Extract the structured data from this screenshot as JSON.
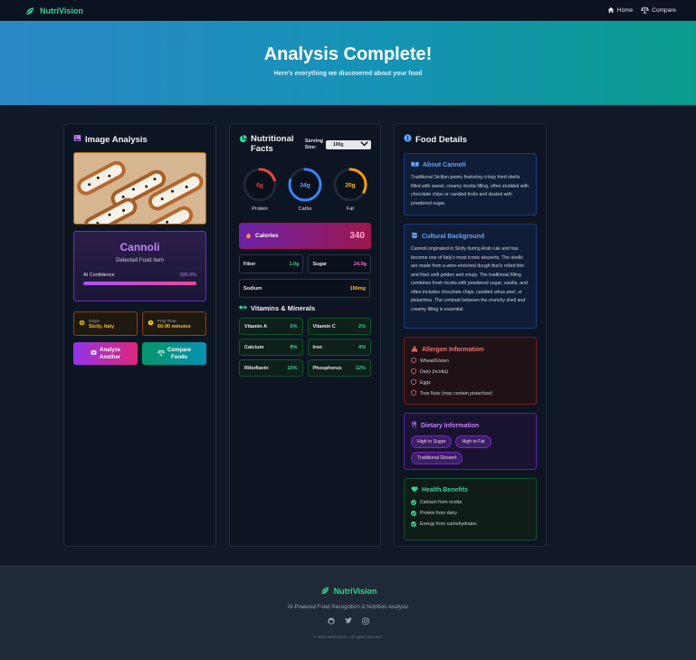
{
  "nav": {
    "brand": "NutriVision",
    "links": [
      {
        "label": "Home",
        "icon": "home-icon"
      },
      {
        "label": "Compare",
        "icon": "compare-icon"
      }
    ]
  },
  "hero": {
    "title": "Analysis Complete!",
    "subtitle": "Here's everything we discovered about your food"
  },
  "image_analysis": {
    "title": "Image Analysis",
    "food_name": "Cannoli",
    "detected_label": "Detected Food Item",
    "confidence_label": "AI Confidence",
    "confidence_value": "100.0%",
    "confidence_fraction": 1.0,
    "origin_label": "Origin",
    "origin_value": "Sicily, Italy",
    "prep_label": "Prep Time",
    "prep_value": "60-90 minutes",
    "analyze_button": [
      "Analyze",
      "Another"
    ],
    "compare_button": [
      "Compare",
      "Foods"
    ]
  },
  "nutrition": {
    "title": [
      "Nutritional",
      "Facts"
    ],
    "serving_label": [
      "Serving",
      "Size:"
    ],
    "serving_value": "100g",
    "rings": [
      {
        "label": "Protein",
        "value": "6g",
        "fraction": 0.2,
        "color": "#ef4444"
      },
      {
        "label": "Carbs",
        "value": "34g",
        "fraction": 0.8,
        "color": "#3b82f6"
      },
      {
        "label": "Fat",
        "value": "20g",
        "fraction": 0.33,
        "color": "#f59e0b"
      }
    ],
    "calories_label": "Calories",
    "calories_value": "340",
    "macros": [
      {
        "label": "Fiber",
        "value": "1.0g",
        "color": "#34d399"
      },
      {
        "label": "Sugar",
        "value": "24.0g",
        "color": "#f472b6"
      }
    ],
    "sodium": {
      "label": "Sodium",
      "value": "190mg",
      "color": "#fbbf24"
    },
    "vitamins_title": "Vitamins & Minerals",
    "vitamins": [
      {
        "label": "Vitamin A",
        "value": "6%"
      },
      {
        "label": "Vitamin C",
        "value": "2%"
      },
      {
        "label": "Calcium",
        "value": "8%"
      },
      {
        "label": "Iron",
        "value": "4%"
      },
      {
        "label": "Riboflavin",
        "value": "10%"
      },
      {
        "label": "Phosphorus",
        "value": "12%"
      }
    ]
  },
  "details": {
    "title": "Food Details",
    "about_title": "About Cannoli",
    "about_text": "Traditional Sicilian pastry featuring crispy fried shells filled with sweet, creamy ricotta filling, often studded with chocolate chips or candied fruits and dusted with powdered sugar.",
    "culture_title": "Cultural Background",
    "culture_text": "Cannoli originated in Sicily during Arab rule and has become one of Italy's most iconic desserts. The shells are made from a wine-enriched dough that's rolled thin and fried until golden and crispy. The traditional filling combines fresh ricotta with powdered sugar, vanilla, and often includes chocolate chips, candied citrus peel, or pistachios. The contrast between the crunchy shell and creamy filling is essential.",
    "allergen_title": "Allergen Information",
    "allergens": [
      "Wheat/Gluten",
      "Dairy (ricotta)",
      "Eggs",
      "Tree Nuts (may contain pistachios)"
    ],
    "dietary_title": "Dietary Information",
    "dietary_tags": [
      "High in Sugar",
      "High in Fat",
      "Traditional Dessert"
    ],
    "health_title": "Health Benefits",
    "benefits": [
      "Calcium from ricotta",
      "Protein from dairy",
      "Energy from carbohydrates"
    ]
  },
  "footer": {
    "brand": "NutriVision",
    "tagline": "AI-Powered Food Recognition & Nutrition Analysis",
    "copyright": "© 2024 NutriVision. All rights reserved."
  }
}
